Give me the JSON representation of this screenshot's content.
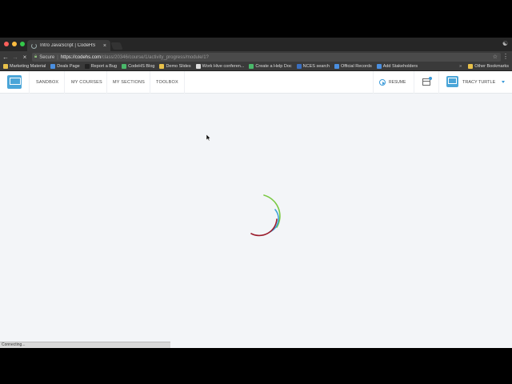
{
  "browser": {
    "tab_title": "Intro JavaScript | CodeHS",
    "tab_close": "×",
    "secure_label": "Secure",
    "url_host": "https://codehs.com",
    "url_path": "/class/20346/course/1/activity_progress/module/1?",
    "bookmarks": [
      {
        "label": "Marketing Material",
        "color": "#e8c14a"
      },
      {
        "label": "Deals Page",
        "color": "#4a8fe0"
      },
      {
        "label": "Report a Bug",
        "color": "#222222"
      },
      {
        "label": "CodeHS Blog",
        "color": "#4ab86a"
      },
      {
        "label": "Demo Slides",
        "color": "#e8c14a"
      },
      {
        "label": "Work Hive conferen...",
        "color": "#dddddd"
      },
      {
        "label": "Create a Help Doc",
        "color": "#4ab86a"
      },
      {
        "label": "NCES search",
        "color": "#3a6fc0"
      },
      {
        "label": "Official Records",
        "color": "#4a8fe0"
      },
      {
        "label": "Add Stakeholders",
        "color": "#4a8fe0"
      }
    ],
    "other_bookmarks": "Other Bookmarks",
    "status_text": "Connecting..."
  },
  "site_nav": {
    "links": [
      "SANDBOX",
      "MY COURSES",
      "MY SECTIONS",
      "TOOLBOX"
    ],
    "resume_label": "RESUME",
    "user_name": "TRACY TURTLE"
  },
  "colors": {
    "accent": "#3a9ad9",
    "spinner_green": "#7ac943",
    "spinner_blue": "#3aa0d8",
    "spinner_red": "#9b1c2c"
  }
}
